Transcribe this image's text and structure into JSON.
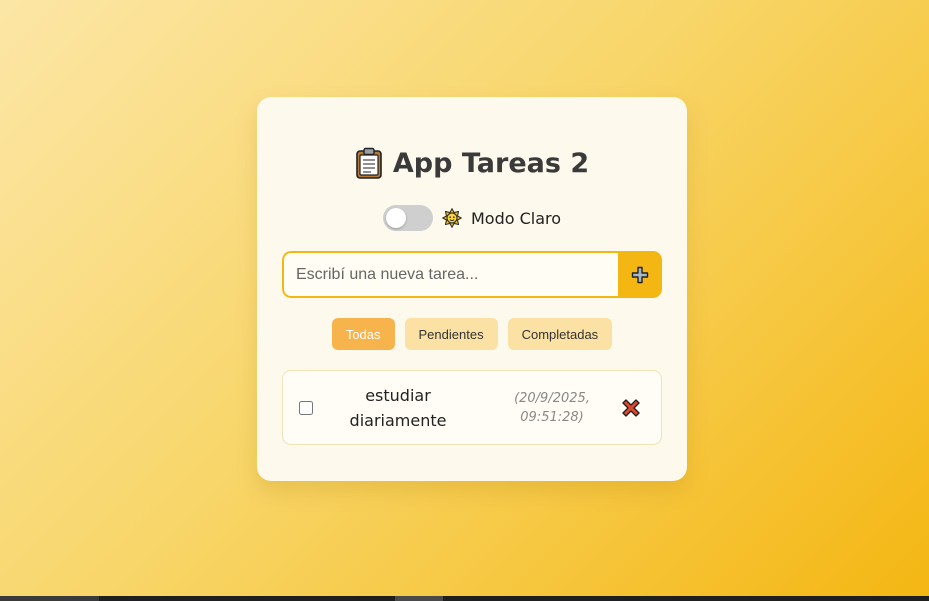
{
  "app": {
    "title": "App Tareas 2",
    "title_icon": "clipboard-icon"
  },
  "theme": {
    "mode_label": "Modo Claro",
    "mode_icon": "sun-icon",
    "dark_enabled": false
  },
  "new_task": {
    "placeholder": "Escribí una nueva tarea...",
    "value": "",
    "add_icon": "plus-icon"
  },
  "filters": {
    "all": "Todas",
    "pending": "Pendientes",
    "completed": "Completadas",
    "active": "all"
  },
  "tasks": [
    {
      "text": "estudiar diariamente",
      "date": "(20/9/2025, 09:51:28)",
      "done": false,
      "delete_icon": "cross-icon"
    }
  ],
  "colors": {
    "accent": "#f4b612",
    "active_filter": "#f7b34c",
    "filter_bg": "#fbe1a3",
    "card_bg": "#fdf9ec"
  }
}
